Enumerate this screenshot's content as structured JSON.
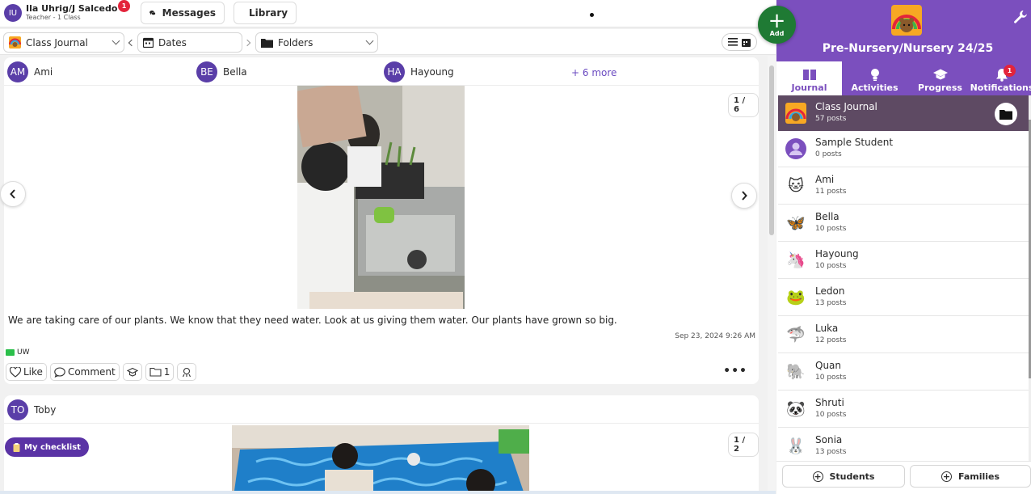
{
  "user": {
    "initials": "IU",
    "name": "Ila Uhrig/J Salcedo",
    "role": "Teacher - 1 Class",
    "badge": "1"
  },
  "topnav": {
    "messages": "Messages",
    "library": "Library"
  },
  "filters": {
    "journal": "Class Journal",
    "dates": "Dates",
    "folders": "Folders"
  },
  "post1": {
    "students": [
      {
        "initials": "AM",
        "name": "Ami"
      },
      {
        "initials": "BE",
        "name": "Bella"
      },
      {
        "initials": "HA",
        "name": "Hayoung"
      }
    ],
    "more": "+ 6 more",
    "counter": "1 / 6",
    "caption": "We are taking care of our plants. We know that they need water. Look at us giving them water. Our plants have grown so big.",
    "timestamp": "Sep 23, 2024 9:26 AM",
    "tag": "UW",
    "like": "Like",
    "comment": "Comment",
    "folder_count": "1"
  },
  "post2": {
    "student": {
      "initials": "TO",
      "name": "Toby"
    },
    "counter": "1 / 2"
  },
  "checklist": "My checklist",
  "panel": {
    "add": "Add",
    "class_name": "Pre-Nursery/Nursery 24/25",
    "tabs": [
      "Journal",
      "Activities",
      "Progress",
      "Notifications"
    ],
    "notif_badge": "1",
    "roster": [
      {
        "name": "Class Journal",
        "posts": "57 posts",
        "icon": "rainbow-bear-icon",
        "glyph": "🌈"
      },
      {
        "name": "Sample Student",
        "posts": "0 posts",
        "icon": "person-icon",
        "glyph": ""
      },
      {
        "name": "Ami",
        "posts": "11 posts",
        "icon": "cat-icon",
        "glyph": "🐱"
      },
      {
        "name": "Bella",
        "posts": "10 posts",
        "icon": "butterfly-icon",
        "glyph": "🦋"
      },
      {
        "name": "Hayoung",
        "posts": "10 posts",
        "icon": "unicorn-icon",
        "glyph": "🦄"
      },
      {
        "name": "Ledon",
        "posts": "13 posts",
        "icon": "frog-icon",
        "glyph": "🐸"
      },
      {
        "name": "Luka",
        "posts": "12 posts",
        "icon": "shark-icon",
        "glyph": "🦈"
      },
      {
        "name": "Quan",
        "posts": "10 posts",
        "icon": "elephant-icon",
        "glyph": "🐘"
      },
      {
        "name": "Shruti",
        "posts": "10 posts",
        "icon": "panda-icon",
        "glyph": "🐼"
      },
      {
        "name": "Sonia",
        "posts": "13 posts",
        "icon": "bunny-icon",
        "glyph": "🐰"
      }
    ],
    "students_btn": "Students",
    "families_btn": "Families"
  },
  "colors": {
    "brand_purple": "#7b4fbe",
    "add_green": "#1f7a34",
    "badge_red": "#e3243b",
    "avatar_purple": "#5a3ea8"
  }
}
